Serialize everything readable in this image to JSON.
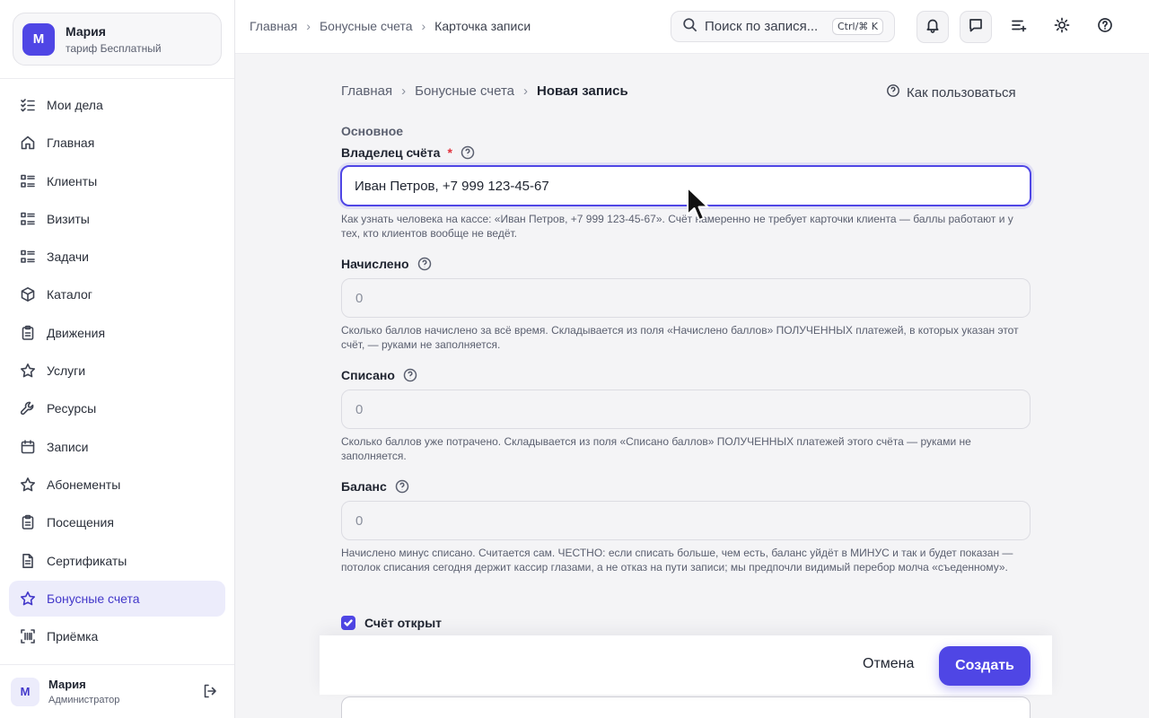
{
  "account": {
    "avatar_letter": "М",
    "name": "Мария",
    "plan": "тариф Бесплатный"
  },
  "sidebar": {
    "items": [
      {
        "label": "Мои дела",
        "icon": "task-list-icon"
      },
      {
        "label": "Главная",
        "icon": "home-icon"
      },
      {
        "label": "Клиенты",
        "icon": "list-icon"
      },
      {
        "label": "Визиты",
        "icon": "list-icon"
      },
      {
        "label": "Задачи",
        "icon": "list-icon"
      },
      {
        "label": "Каталог",
        "icon": "box-icon"
      },
      {
        "label": "Движения",
        "icon": "clipboard-icon"
      },
      {
        "label": "Услуги",
        "icon": "star-icon"
      },
      {
        "label": "Ресурсы",
        "icon": "wrench-icon"
      },
      {
        "label": "Записи",
        "icon": "calendar-icon"
      },
      {
        "label": "Абонементы",
        "icon": "star-icon"
      },
      {
        "label": "Посещения",
        "icon": "clipboard-icon"
      },
      {
        "label": "Сертификаты",
        "icon": "document-icon"
      },
      {
        "label": "Бонусные счета",
        "icon": "star-icon",
        "active": true
      },
      {
        "label": "Приёмка",
        "icon": "barcode-icon"
      }
    ]
  },
  "user": {
    "avatar_letter": "М",
    "name": "Мария",
    "role": "Администратор"
  },
  "topbar": {
    "breadcrumb": [
      "Главная",
      "Бонусные счета",
      "Карточка записи"
    ],
    "search_placeholder": "Поиск по запися...",
    "search_shortcut": "Ctrl/⌘ K"
  },
  "page": {
    "breadcrumb": [
      "Главная",
      "Бонусные счета",
      "Новая запись"
    ],
    "howto": "Как пользоваться",
    "section": "Основное"
  },
  "form": {
    "owner": {
      "label": "Владелец счёта",
      "required_mark": "*",
      "value": "Иван Петров, +7 999 123-45-67",
      "hint": "Как узнать человека на кассе: «Иван Петров, +7 999 123-45-67». Счёт намеренно не требует карточки клиента — баллы работают и у тех, кто клиентов вообще не ведёт."
    },
    "accrued": {
      "label": "Начислено",
      "placeholder": "0",
      "hint": "Сколько баллов начислено за всё время. Складывается из поля «Начислено баллов» ПОЛУЧЕННЫХ платежей, в которых указан этот счёт, — руками не заполняется."
    },
    "spent": {
      "label": "Списано",
      "placeholder": "0",
      "hint": "Сколько баллов уже потрачено. Складывается из поля «Списано баллов» ПОЛУЧЕННЫХ платежей этого счёта — руками не заполняется."
    },
    "balance": {
      "label": "Баланс",
      "placeholder": "0",
      "hint": "Начислено минус списано. Считается сам. ЧЕСТНО: если списать больше, чем есть, баланс уйдёт в МИНУС и так и будет показан — потолок списания сегодня держит кассир глазами, а не отказ на пути записи; мы предпочли видимый перебор молча «съеденному»."
    },
    "open_checkbox": {
      "label": "Счёт открыт",
      "checked": true
    }
  },
  "footer": {
    "cancel": "Отмена",
    "create": "Создать"
  },
  "colors": {
    "accent": "#4f46e5",
    "active_bg": "#ececfb",
    "required": "#e0313c"
  }
}
